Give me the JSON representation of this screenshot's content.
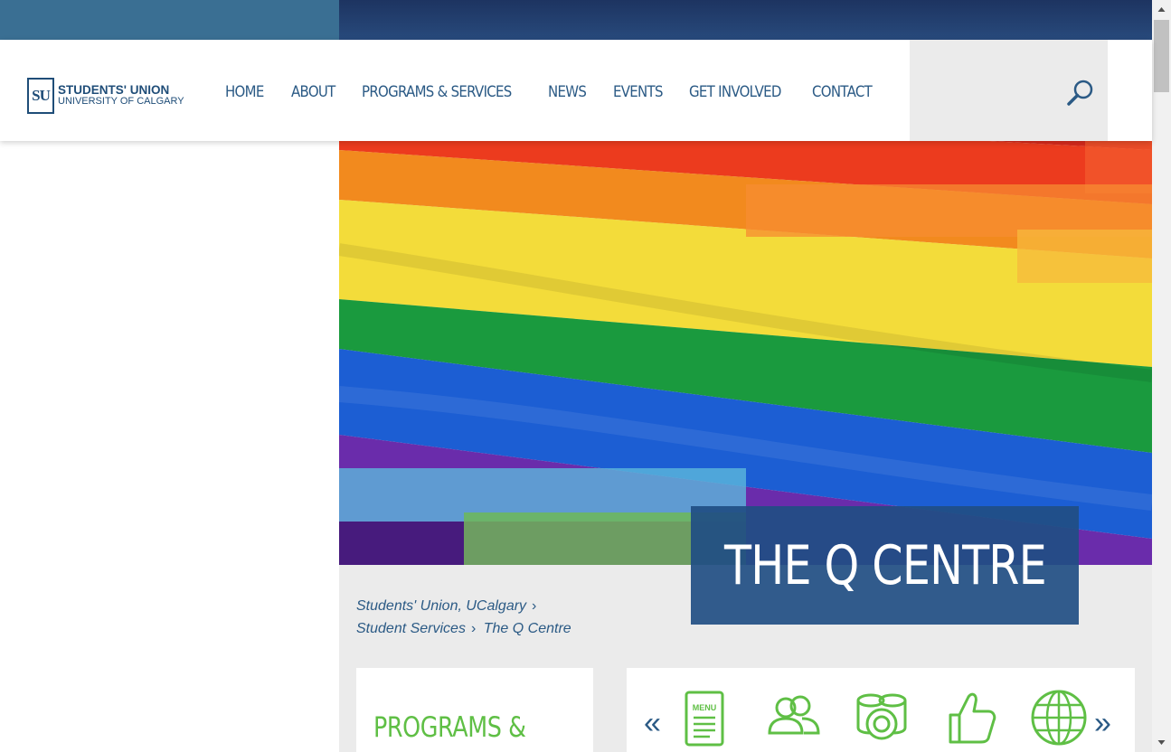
{
  "header": {
    "logo": {
      "mark": "SU",
      "line1": "STUDENTS' UNION",
      "line2": "UNIVERSITY OF CALGARY"
    },
    "nav": [
      "HOME",
      "ABOUT",
      "PROGRAMS & SERVICES",
      "NEWS",
      "EVENTS",
      "GET INVOLVED",
      "CONTACT"
    ],
    "search_icon": "search-icon"
  },
  "hero": {
    "title": "THE Q CENTRE",
    "image": "rainbow-flag"
  },
  "breadcrumb": [
    "Students' Union, UCalgary",
    "Student Services",
    "The Q Centre"
  ],
  "programs_card": {
    "title": "PROGRAMS &"
  },
  "carousel": {
    "menu_icon_label": "MENU",
    "icons": [
      "menu-icon",
      "people-icon",
      "coins-icon",
      "thumbs-up-icon",
      "globe-icon"
    ]
  },
  "colors": {
    "brand_blue": "#1f4d78",
    "nav_blue": "#2b5a85",
    "accent_green": "#5fbf45",
    "title_box": "#214e83"
  }
}
